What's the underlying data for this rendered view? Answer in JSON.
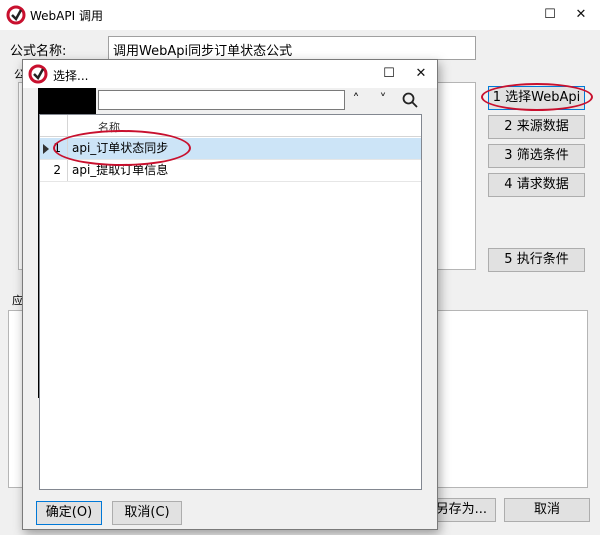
{
  "main_window": {
    "title": "WebAPI 调用",
    "formula_label": "公式名称:",
    "formula_value": "调用WebApi同步订单状态公式",
    "side_buttons": [
      "1 选择WebApi",
      "2 来源数据",
      "3 筛选条件",
      "4 请求数据",
      "5 执行条件"
    ],
    "bottom_buttons": [
      "另存为...",
      "取消"
    ],
    "partial_labels": [
      "公",
      "应"
    ]
  },
  "dialog": {
    "title": "选择...",
    "search_placeholder": "",
    "grid": {
      "column_header": "名称",
      "rows": [
        {
          "num": "1",
          "name": "api_订单状态同步",
          "selected": true
        },
        {
          "num": "2",
          "name": "api_提取订单信息",
          "selected": false
        }
      ]
    },
    "buttons": {
      "ok": "确定(O)",
      "cancel": "取消(C)"
    }
  },
  "colors": {
    "selection": "#cce4f7",
    "annotation": "#c8102e",
    "accent": "#0078d7"
  }
}
